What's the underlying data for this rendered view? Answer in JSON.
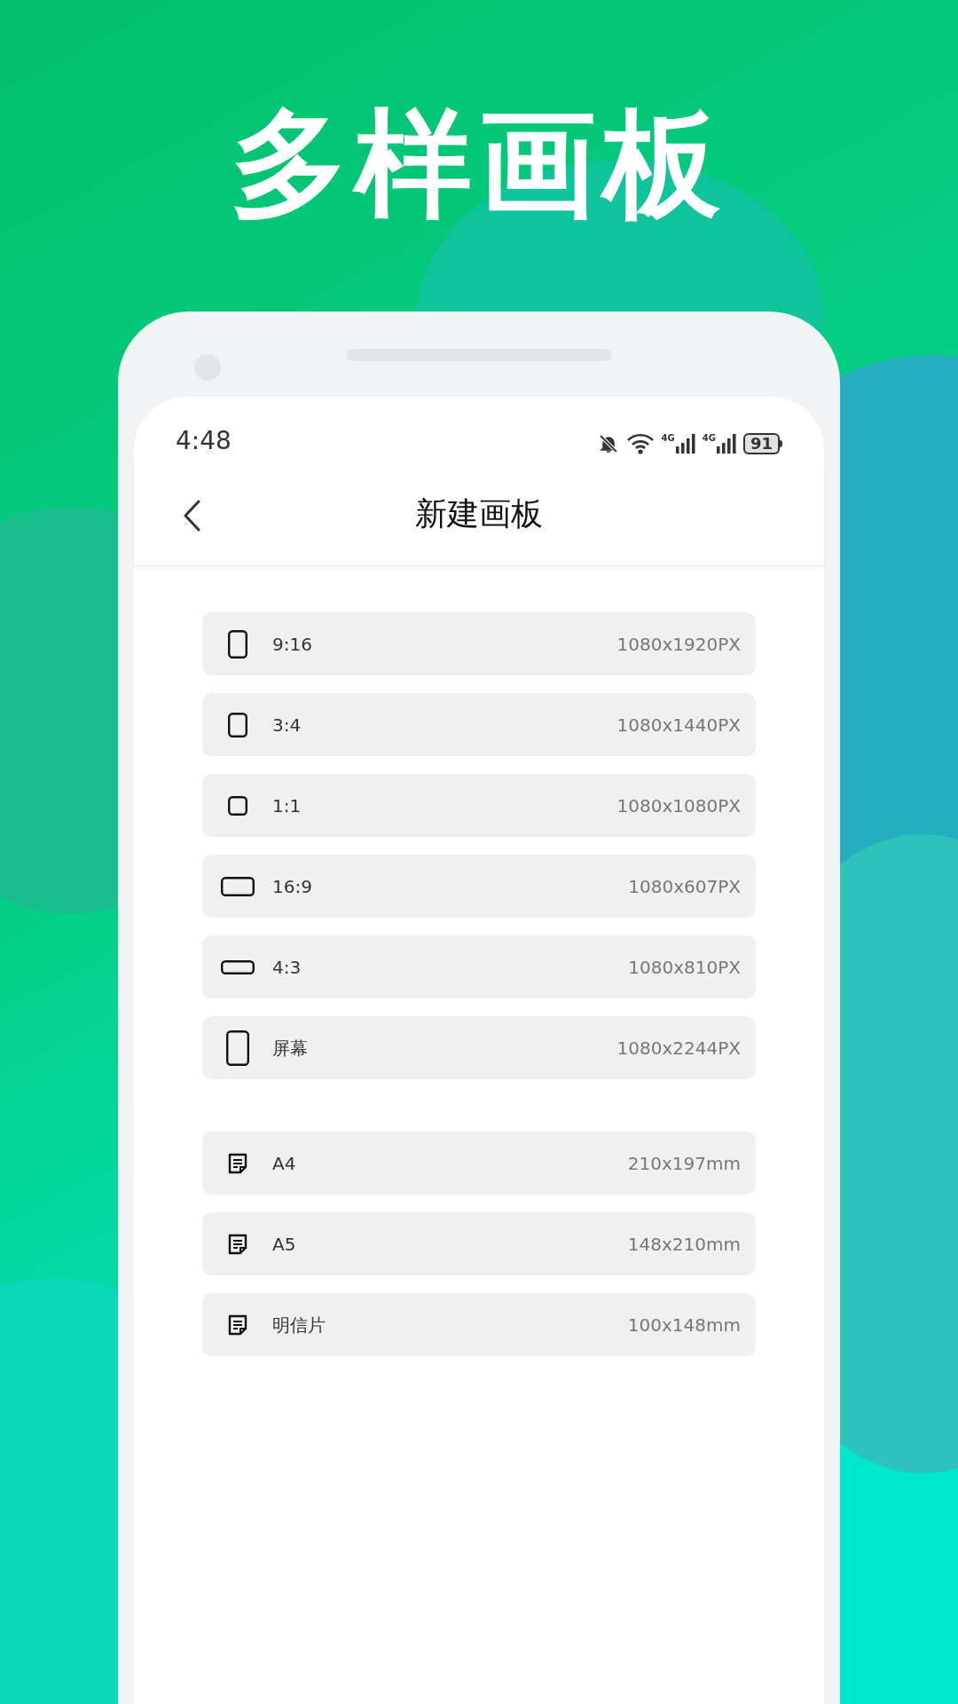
{
  "headline": "多样画板",
  "status_bar": {
    "time": "4:48",
    "signals": [
      {
        "network": "4G"
      },
      {
        "network": "4G"
      }
    ],
    "battery": "91"
  },
  "nav": {
    "title": "新建画板"
  },
  "sections": [
    {
      "items": [
        {
          "kind": "tall",
          "label": "9:16",
          "size": "1080x1920PX"
        },
        {
          "kind": "portrait",
          "label": "3:4",
          "size": "1080x1440PX"
        },
        {
          "kind": "square",
          "label": "1:1",
          "size": "1080x1080PX"
        },
        {
          "kind": "wide",
          "label": "16:9",
          "size": "1080x607PX"
        },
        {
          "kind": "landscape",
          "label": "4:3",
          "size": "1080x810PX"
        },
        {
          "kind": "screen",
          "label": "屏幕",
          "size": "1080x2244PX"
        }
      ]
    },
    {
      "items": [
        {
          "kind": "paper",
          "label": "A4",
          "size": "210x197mm"
        },
        {
          "kind": "paper",
          "label": "A5",
          "size": "148x210mm"
        },
        {
          "kind": "paper",
          "label": "明信片",
          "size": "100x148mm"
        }
      ]
    }
  ]
}
